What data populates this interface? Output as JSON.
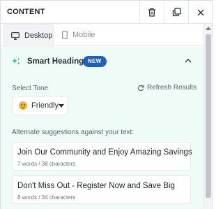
{
  "header": {
    "title": "CONTENT",
    "actions": [
      "trash-icon",
      "duplicate-icon",
      "close-icon"
    ]
  },
  "tabs": [
    {
      "label": "Desktop",
      "icon": "monitor-icon",
      "active": true
    },
    {
      "label": "Mobile",
      "icon": "phone-icon",
      "active": false
    }
  ],
  "smart_headings": {
    "title": "Smart Headings",
    "badge": "NEW",
    "icon": "sparkle-icon",
    "expanded": true
  },
  "tone": {
    "label": "Select Tone",
    "refresh_label": "Refresh Results",
    "selected": "Friendly",
    "selected_icon": "smile-emoji"
  },
  "suggestions": {
    "label": "Alternate suggestions against your text:",
    "items": [
      {
        "text": "Join Our Community and Enjoy Amazing Savings",
        "meta": "7 words / 38 characters"
      },
      {
        "text": "Don't Miss Out - Register Now and Save Big",
        "meta": "8 words / 34 characters"
      }
    ]
  },
  "colors": {
    "panel_bg": "#effbf6",
    "badge_bg": "#1e5fbf",
    "sparkle": "#23b58a"
  }
}
